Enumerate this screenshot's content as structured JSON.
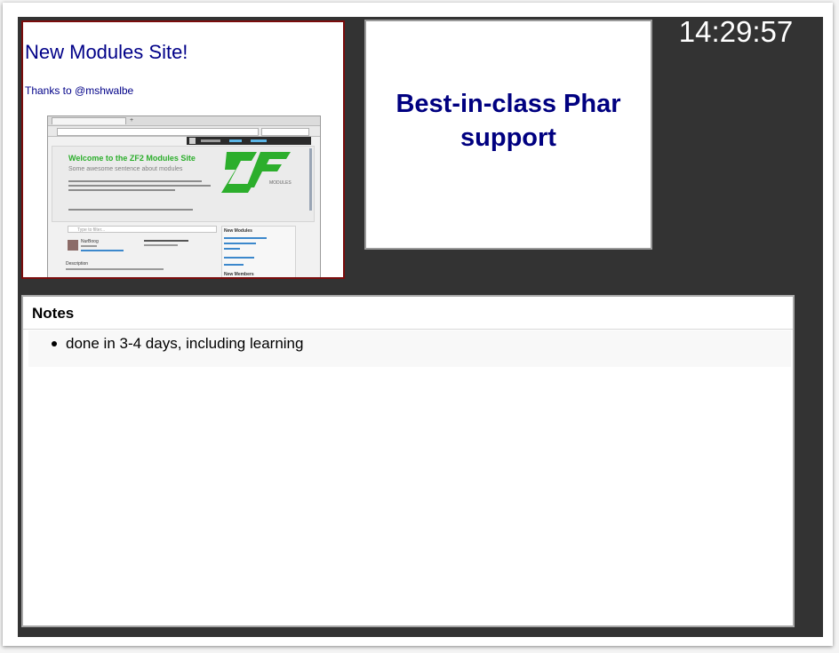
{
  "clock": {
    "time": "14:29:57"
  },
  "current_slide": {
    "title": "New Modules Site!",
    "body": "Thanks to @mshwalbe",
    "screenshot": {
      "hero_title": "Welcome to the ZF2 Modules Site",
      "hero_subtitle": "Some awesome sentence about modules",
      "search_placeholder": "Type to filter...",
      "row_name": "NurBoog",
      "description_label": "Description",
      "sidebar_heading_new_modules": "New Modules",
      "sidebar_heading_new_members": "New Members",
      "logo_caption": "MODULES"
    }
  },
  "next_slide": {
    "title": "Best-in-class Phar support"
  },
  "notes": {
    "heading": "Notes",
    "items": [
      "done in 3-4 days, including learning"
    ]
  },
  "colors": {
    "console_bg": "#333333",
    "current_slide_border": "#7a0c0c",
    "slide_text": "#000088",
    "zf_green": "#2cae2c"
  }
}
